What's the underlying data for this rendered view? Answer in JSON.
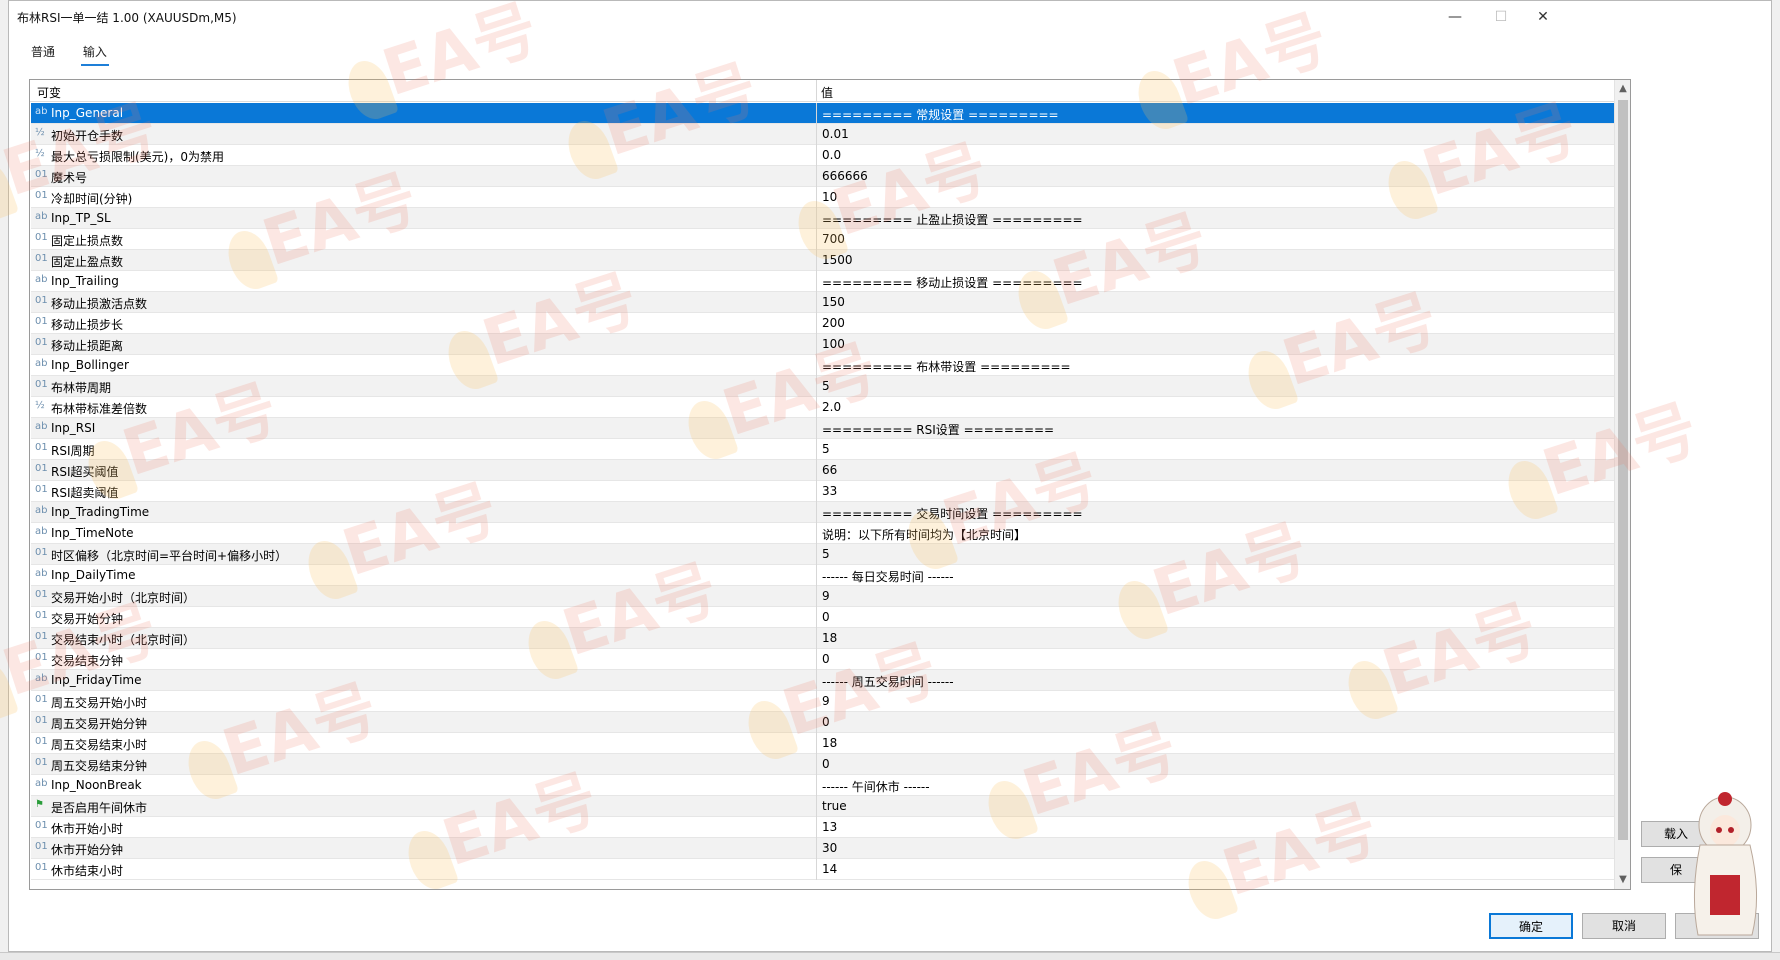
{
  "window": {
    "title": "布林RSI一单一结 1.00 (XAUUSDm,M5)",
    "min": "—",
    "max": "☐",
    "close": "✕"
  },
  "tabs": [
    {
      "label": "普通"
    },
    {
      "label": "输入"
    }
  ],
  "grid": {
    "col_variable": "可变",
    "col_value": "值",
    "rows": [
      {
        "icon": "ab",
        "name": "Inp_General",
        "value": "========= 常规设置 ========="
      },
      {
        "icon": "½",
        "name": "初始开仓手数",
        "value": "0.01"
      },
      {
        "icon": "½",
        "name": "最大总亏损限制(美元)，0为禁用",
        "value": "0.0"
      },
      {
        "icon": "01",
        "name": "魔术号",
        "value": "666666"
      },
      {
        "icon": "01",
        "name": "冷却时间(分钟)",
        "value": "10"
      },
      {
        "icon": "ab",
        "name": "Inp_TP_SL",
        "value": "========= 止盈止损设置 ========="
      },
      {
        "icon": "01",
        "name": "固定止损点数",
        "value": "700"
      },
      {
        "icon": "01",
        "name": "固定止盈点数",
        "value": "1500"
      },
      {
        "icon": "ab",
        "name": "Inp_Trailing",
        "value": "========= 移动止损设置 ========="
      },
      {
        "icon": "01",
        "name": "移动止损激活点数",
        "value": "150"
      },
      {
        "icon": "01",
        "name": "移动止损步长",
        "value": "200"
      },
      {
        "icon": "01",
        "name": "移动止损距离",
        "value": "100"
      },
      {
        "icon": "ab",
        "name": "Inp_Bollinger",
        "value": "========= 布林带设置 ========="
      },
      {
        "icon": "01",
        "name": "布林带周期",
        "value": "5"
      },
      {
        "icon": "½",
        "name": "布林带标准差倍数",
        "value": "2.0"
      },
      {
        "icon": "ab",
        "name": "Inp_RSI",
        "value": "========= RSI设置 ========="
      },
      {
        "icon": "01",
        "name": "RSI周期",
        "value": "5"
      },
      {
        "icon": "01",
        "name": "RSI超买阈值",
        "value": "66"
      },
      {
        "icon": "01",
        "name": "RSI超卖阈值",
        "value": "33"
      },
      {
        "icon": "ab",
        "name": "Inp_TradingTime",
        "value": "========= 交易时间设置 ========="
      },
      {
        "icon": "ab",
        "name": "Inp_TimeNote",
        "value": "说明：以下所有时间均为【北京时间】"
      },
      {
        "icon": "01",
        "name": "时区偏移（北京时间=平台时间+偏移小时）",
        "value": "5"
      },
      {
        "icon": "ab",
        "name": "Inp_DailyTime",
        "value": "------ 每日交易时间 ------"
      },
      {
        "icon": "01",
        "name": "交易开始小时（北京时间）",
        "value": "9"
      },
      {
        "icon": "01",
        "name": "交易开始分钟",
        "value": "0"
      },
      {
        "icon": "01",
        "name": "交易结束小时（北京时间）",
        "value": "18"
      },
      {
        "icon": "01",
        "name": "交易结束分钟",
        "value": "0"
      },
      {
        "icon": "ab",
        "name": "Inp_FridayTime",
        "value": "------ 周五交易时间 ------"
      },
      {
        "icon": "01",
        "name": "周五交易开始小时",
        "value": "9"
      },
      {
        "icon": "01",
        "name": "周五交易开始分钟",
        "value": "0"
      },
      {
        "icon": "01",
        "name": "周五交易结束小时",
        "value": "18"
      },
      {
        "icon": "01",
        "name": "周五交易结束分钟",
        "value": "0"
      },
      {
        "icon": "ab",
        "name": "Inp_NoonBreak",
        "value": "------ 午间休市 ------"
      },
      {
        "icon": "⚑",
        "name": "是否启用午间休市",
        "value": "true"
      },
      {
        "icon": "01",
        "name": "休市开始小时",
        "value": "13"
      },
      {
        "icon": "01",
        "name": "休市开始分钟",
        "value": "30"
      },
      {
        "icon": "01",
        "name": "休市结束小时",
        "value": "14"
      }
    ]
  },
  "side_buttons": {
    "load": "载入",
    "save": "保"
  },
  "footer": {
    "ok": "确定",
    "cancel": "取消",
    "reset": "重置"
  },
  "watermark_text": "EA号"
}
